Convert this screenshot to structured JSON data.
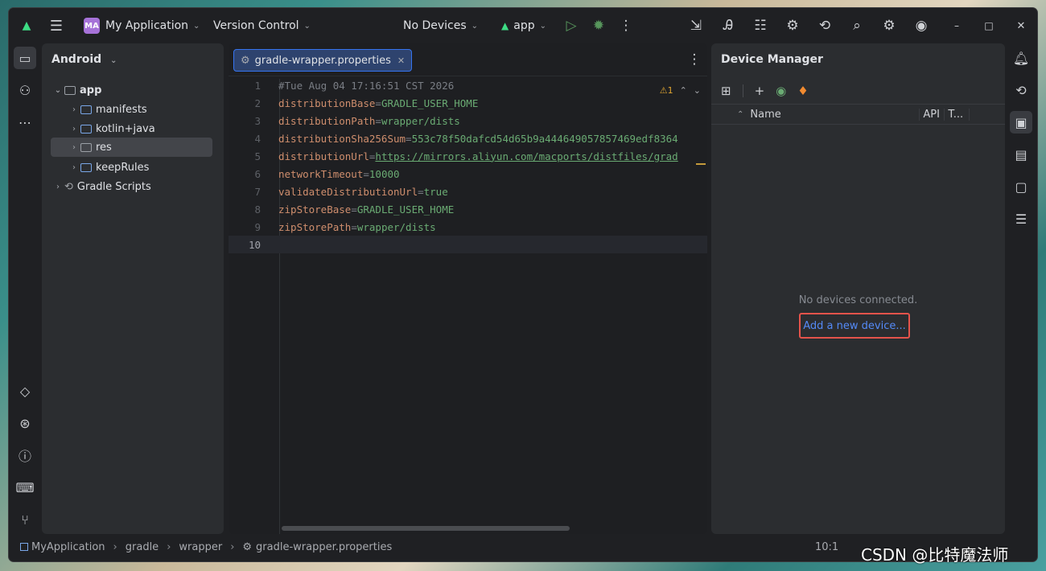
{
  "titlebar": {
    "project_badge": "MA",
    "project_name": "My Application",
    "vcs": "Version Control",
    "devices": "No Devices",
    "run_config": "app"
  },
  "project_panel": {
    "view_mode": "Android",
    "tree": [
      {
        "label": "app",
        "level": 0,
        "expanded": true
      },
      {
        "label": "manifests",
        "level": 1
      },
      {
        "label": "kotlin+java",
        "level": 1
      },
      {
        "label": "res",
        "level": 1,
        "selected": true
      },
      {
        "label": "keepRules",
        "level": 1
      },
      {
        "label": "Gradle Scripts",
        "level": 0
      }
    ]
  },
  "editor": {
    "tab_label": "gradle-wrapper.properties",
    "warning_count": "1",
    "lines": [
      {
        "n": "1",
        "comment": "#Tue Aug 04 17:16:51 CST 2026"
      },
      {
        "n": "2",
        "key": "distributionBase",
        "val": "GRADLE_USER_HOME"
      },
      {
        "n": "3",
        "key": "distributionPath",
        "val": "wrapper/dists"
      },
      {
        "n": "4",
        "key": "distributionSha256Sum",
        "val": "553c78f50dafcd54d65b9a444649057857469edf8364"
      },
      {
        "n": "5",
        "key": "distributionUrl",
        "val": "https://mirrors.aliyun.com/macports/distfiles/grad"
      },
      {
        "n": "6",
        "key": "networkTimeout",
        "val": "10000"
      },
      {
        "n": "7",
        "key": "validateDistributionUrl",
        "val": "true"
      },
      {
        "n": "8",
        "key": "zipStoreBase",
        "val": "GRADLE_USER_HOME"
      },
      {
        "n": "9",
        "key": "zipStorePath",
        "val": "wrapper/dists"
      },
      {
        "n": "10",
        "current": true
      }
    ]
  },
  "device_manager": {
    "title": "Device Manager",
    "columns": {
      "name": "Name",
      "api": "API",
      "type": "T..."
    },
    "empty_text": "No devices connected.",
    "add_link": "Add a new device..."
  },
  "statusbar": {
    "crumbs": [
      "MyApplication",
      "gradle",
      "wrapper",
      "gradle-wrapper.properties"
    ],
    "position": "10:1",
    "watermark": "CSDN @比特魔法师"
  },
  "colors": {
    "accent": "#3574f0",
    "highlight_box": "#e5534b",
    "link": "#548af7"
  }
}
